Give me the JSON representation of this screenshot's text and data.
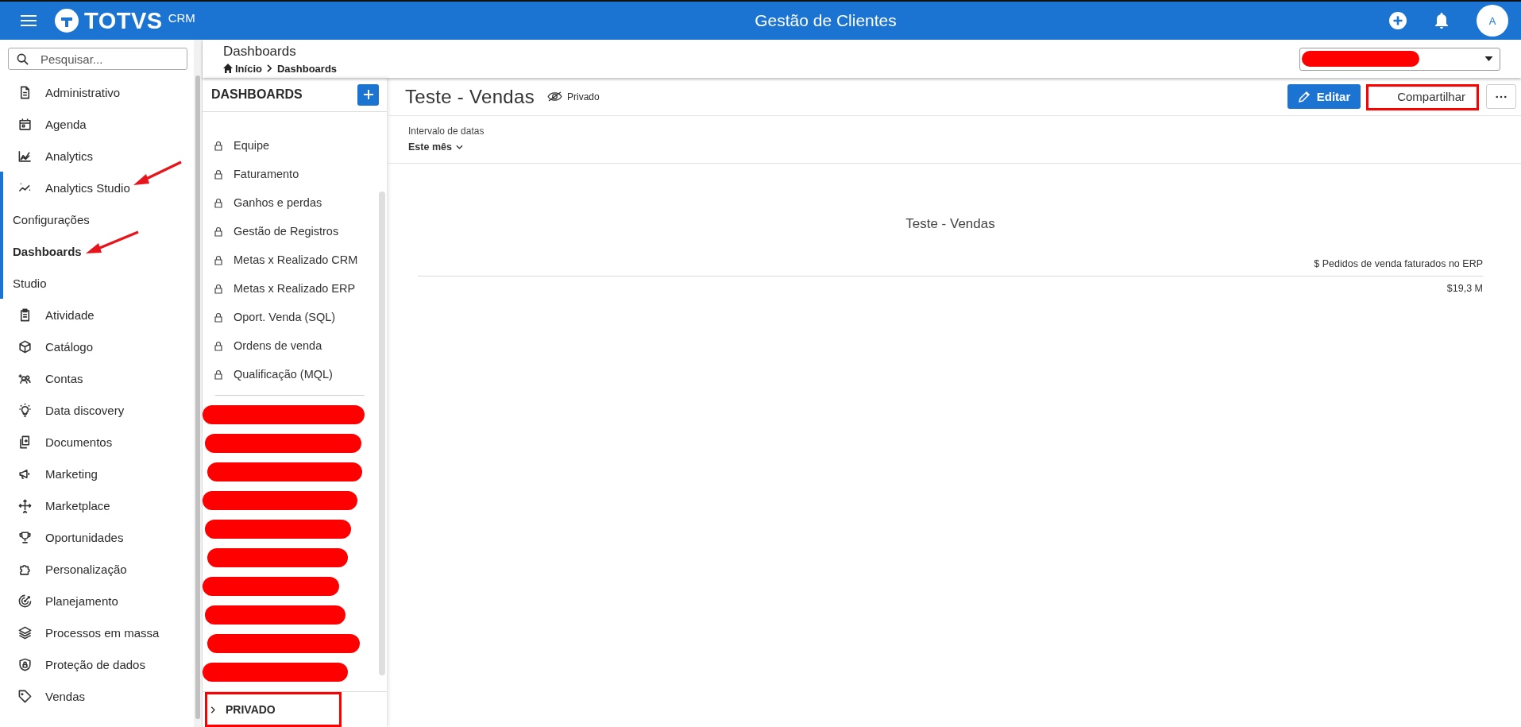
{
  "header": {
    "logo_text": "TOTVS",
    "logo_suffix": "CRM",
    "title": "Gestão de Clientes",
    "avatar": "A"
  },
  "sidebar": {
    "search": {
      "placeholder": "Pesquisar..."
    },
    "items": [
      {
        "label": "Administrativo",
        "selected": false
      },
      {
        "label": "Agenda",
        "selected": false
      },
      {
        "label": "Analytics",
        "selected": false
      },
      {
        "label": "Analytics Studio",
        "selected": false,
        "expanded": true,
        "children": [
          {
            "label": "Configurações",
            "selected": false
          },
          {
            "label": "Dashboards",
            "selected": true
          },
          {
            "label": "Studio",
            "selected": false
          }
        ]
      },
      {
        "label": "Atividade",
        "selected": false
      },
      {
        "label": "Catálogo",
        "selected": false
      },
      {
        "label": "Contas",
        "selected": false
      },
      {
        "label": "Data discovery",
        "selected": false
      },
      {
        "label": "Documentos",
        "selected": false
      },
      {
        "label": "Marketing",
        "selected": false
      },
      {
        "label": "Marketplace",
        "selected": false
      },
      {
        "label": "Oportunidades",
        "selected": false
      },
      {
        "label": "Personalização",
        "selected": false
      },
      {
        "label": "Planejamento",
        "selected": false
      },
      {
        "label": "Processos em massa",
        "selected": false
      },
      {
        "label": "Proteção de dados",
        "selected": false
      },
      {
        "label": "Vendas",
        "selected": false
      }
    ]
  },
  "page": {
    "title": "Dashboards",
    "breadcrumb": [
      {
        "label": "Início",
        "kind": "home"
      },
      {
        "label": "Dashboards",
        "kind": "current"
      }
    ]
  },
  "dashboards_panel": {
    "title": "DASHBOARDS",
    "items": [
      {
        "label": "Equipe",
        "locked": true
      },
      {
        "label": "Faturamento",
        "locked": true
      },
      {
        "label": "Ganhos e perdas",
        "locked": true
      },
      {
        "label": "Gestão de Registros",
        "locked": true
      },
      {
        "label": "Metas x Realizado CRM",
        "locked": true
      },
      {
        "label": "Metas x Realizado ERP",
        "locked": true
      },
      {
        "label": "Oport. Venda (SQL)",
        "locked": true
      },
      {
        "label": "Ordens de venda",
        "locked": true
      },
      {
        "label": "Qualificação (MQL)",
        "locked": true
      }
    ],
    "footer": {
      "label": "PRIVADO",
      "expanded": false
    }
  },
  "dashboard": {
    "title": "Teste - Vendas",
    "visibility": "Privado",
    "edit_button": "Editar",
    "share_button": "Compartilhar",
    "filter": {
      "label": "Intervalo de datas",
      "value": "Este mês"
    },
    "widget": {
      "title": "Teste - Vendas",
      "column": "$ Pedidos de venda faturados no ERP",
      "value": "$19,3 M"
    }
  }
}
